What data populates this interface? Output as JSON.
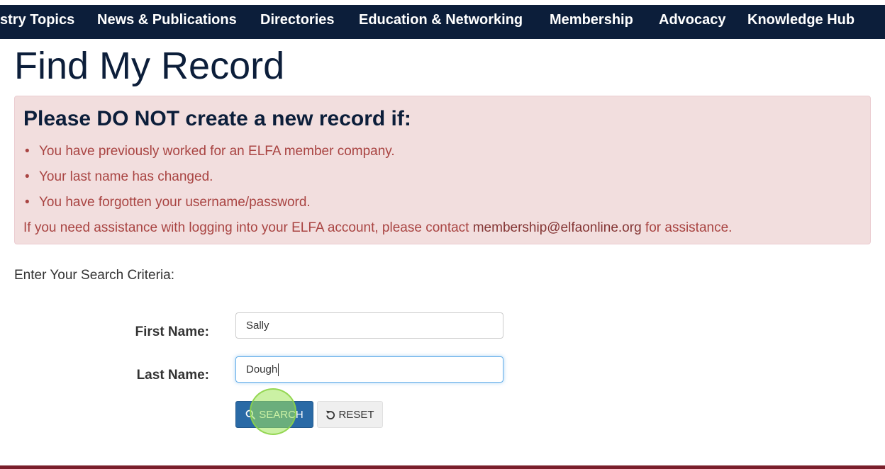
{
  "nav": {
    "items": [
      "stry Topics",
      "News & Publications",
      "Directories",
      "Education & Networking",
      "Membership",
      "Advocacy",
      "Knowledge Hub"
    ]
  },
  "page": {
    "title": "Find My Record"
  },
  "alert": {
    "heading": "Please DO NOT create a new record if:",
    "items": [
      "You have previously worked for an ELFA member company.",
      "Your last name has changed.",
      "You have forgotten your username/password."
    ],
    "footer_prefix": "If you need assistance with logging into your ELFA account, please contact ",
    "footer_email": "membership@elfaonline.org",
    "footer_suffix": " for assistance."
  },
  "form": {
    "criteria_label": "Enter Your Search Criteria:",
    "first_name_label": "First Name:",
    "first_name_value": "Sally",
    "last_name_label": "Last Name:",
    "last_name_value": "Dough",
    "search_label": "SEARCH",
    "reset_label": "RESET"
  },
  "colors": {
    "nav_bg": "#0c1e3a",
    "alert_bg": "#f2dede",
    "alert_text": "#a94442",
    "primary_button": "#2a6aa6",
    "footer_bar": "#7a1f2b"
  }
}
